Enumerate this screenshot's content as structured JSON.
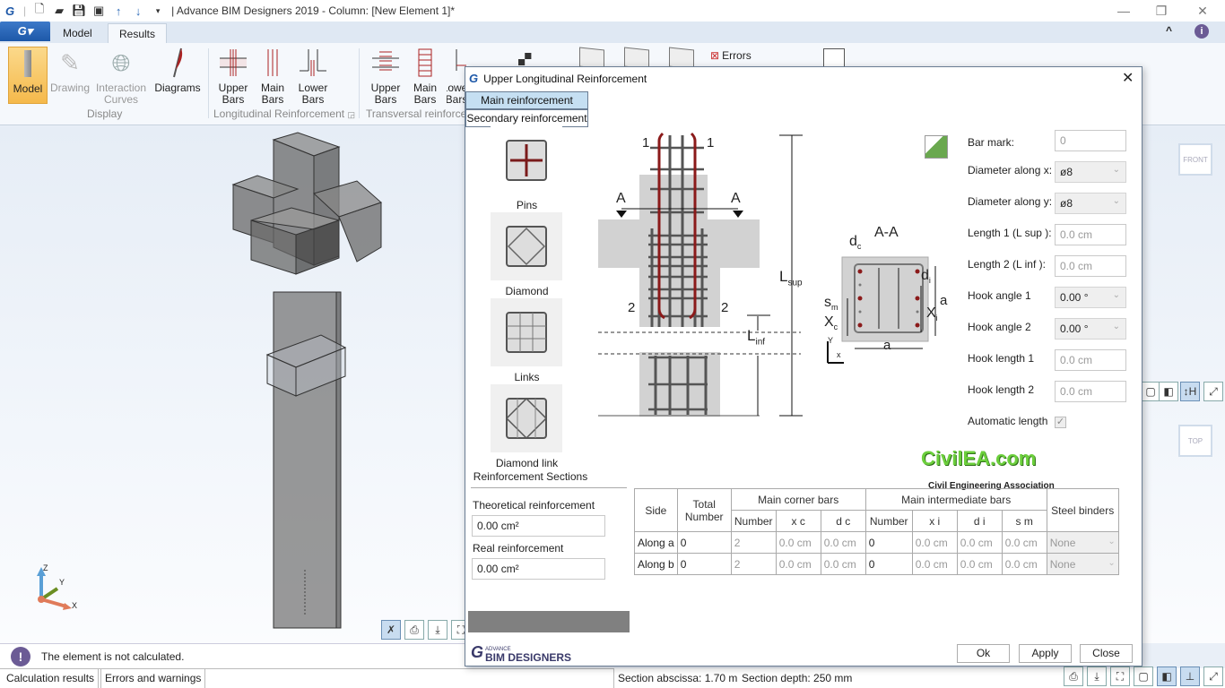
{
  "window": {
    "title": "| Advance BIM Designers 2019 - Column: [New Element 1]*",
    "minimize": "—",
    "restore": "❐",
    "close": "✕"
  },
  "quick_access": [
    "app-logo-icon",
    "new-file-icon",
    "open-icon",
    "save-icon",
    "save-as-icon",
    "arrow-up-icon",
    "arrow-down-icon",
    "dropdown-icon"
  ],
  "ribbon": {
    "app_button": "G▾",
    "tabs": [
      {
        "label": "Model",
        "active": false
      },
      {
        "label": "Results",
        "active": true
      }
    ],
    "groups": {
      "display": {
        "label": "Display",
        "buttons": [
          {
            "label": "Model",
            "state": "selected"
          },
          {
            "label": "Drawing",
            "state": "disabled"
          },
          {
            "label": "Interaction Curves",
            "state": "disabled"
          },
          {
            "label": "Diagrams",
            "state": "normal"
          }
        ]
      },
      "longitudinal": {
        "label": "Longitudinal Reinforcement",
        "buttons": [
          {
            "label": "Upper Bars"
          },
          {
            "label": "Main Bars"
          },
          {
            "label": "Lower Bars"
          }
        ]
      },
      "transversal": {
        "label": "Transversal reinforcement",
        "buttons": [
          {
            "label": "Upper Bars"
          },
          {
            "label": "Main Bars"
          },
          {
            "label": "Lower Bars"
          }
        ]
      },
      "errors_label": "Errors"
    },
    "collapse": "^",
    "info": "i"
  },
  "dialog": {
    "title": "Upper Longitudinal Reinforcement",
    "tabs": [
      {
        "label": "Main reinforcement",
        "active": true
      },
      {
        "label": "Secondary reinforcement",
        "active": false
      }
    ],
    "sections": [
      {
        "label": "Pins",
        "selected": true
      },
      {
        "label": "Diamond",
        "selected": false
      },
      {
        "label": "Links",
        "selected": false
      },
      {
        "label": "Diamond link",
        "selected": false
      }
    ],
    "sections_group_label": "Reinforcement Sections",
    "theoretical": {
      "label": "Theoretical reinforcement",
      "value": "0.00 cm²"
    },
    "real": {
      "label": "Real reinforcement",
      "value": "0.00 cm²"
    },
    "diagram": {
      "marks": {
        "one": "1",
        "two": "2",
        "a": "A",
        "lsup": "L",
        "lsup_sub": "sup",
        "linf": "L",
        "linf_sub": "inf"
      },
      "section": {
        "title": "A-A",
        "dc": "d",
        "dc_sub": "c",
        "di": "d",
        "di_sub": "i",
        "sm": "s",
        "sm_sub": "m",
        "xc": "X",
        "xc_sub": "c",
        "xi": "X",
        "xi_sub": "i",
        "a": "a",
        "y": "Y",
        "x": "x"
      }
    },
    "fields": [
      {
        "label": "Bar mark:",
        "value": "0",
        "type": "text"
      },
      {
        "label": "Diameter along x:",
        "value": "ø8",
        "type": "combo"
      },
      {
        "label": "Diameter along y:",
        "value": "ø8",
        "type": "combo"
      },
      {
        "label": "Length 1 (L sup ):",
        "value": "0.0 cm",
        "type": "text"
      },
      {
        "label": "Length 2 (L inf ):",
        "value": "0.0 cm",
        "type": "text"
      },
      {
        "label": "Hook angle 1",
        "value": "0.00 °",
        "type": "combo"
      },
      {
        "label": "Hook angle 2",
        "value": "0.00 °",
        "type": "combo"
      },
      {
        "label": "Hook length 1",
        "value": "0.0 cm",
        "type": "text"
      },
      {
        "label": "Hook length 2",
        "value": "0.0 cm",
        "type": "text"
      }
    ],
    "automatic_length": {
      "label": "Automatic length",
      "checked": true
    },
    "watermark": {
      "logo": "CivilEA.com",
      "tagline": "Civil Engineering Association"
    },
    "table": {
      "headers": {
        "side": "Side",
        "total": "Total Number",
        "corner": "Main corner bars",
        "intermediate": "Main intermediate bars",
        "binders": "Steel binders",
        "corner_sub": [
          "Number",
          "x c",
          "d c"
        ],
        "inter_sub": [
          "Number",
          "x i",
          "d i",
          "s m"
        ]
      },
      "rows": [
        {
          "side": "Along a",
          "total": "0",
          "c_num": "2",
          "xc": "0.0 cm",
          "dc": "0.0 cm",
          "i_num": "0",
          "xi": "0.0 cm",
          "di": "0.0 cm",
          "sm": "0.0 cm",
          "binders": "None"
        },
        {
          "side": "Along b",
          "total": "0",
          "c_num": "2",
          "xc": "0.0 cm",
          "dc": "0.0 cm",
          "i_num": "0",
          "xi": "0.0 cm",
          "di": "0.0 cm",
          "sm": "0.0 cm",
          "binders": "None"
        }
      ]
    },
    "brand": {
      "small": "ADVANCE",
      "large": "BIM DESIGNERS"
    },
    "buttons": {
      "ok": "Ok",
      "apply": "Apply",
      "close": "Close"
    }
  },
  "viewport": {
    "view_cube_front": "FRONT",
    "view_cube_top": "TOP",
    "axes": {
      "z": "Z",
      "y": "Y",
      "x": "X"
    }
  },
  "status": {
    "message": "The element is not calculated.",
    "section_abscissa": "Section abscissa: 1.70 m",
    "section_depth": "Section depth: 250 mm"
  },
  "bottom_tabs": [
    {
      "label": "Calculation results"
    },
    {
      "label": "Errors and warnings"
    }
  ]
}
